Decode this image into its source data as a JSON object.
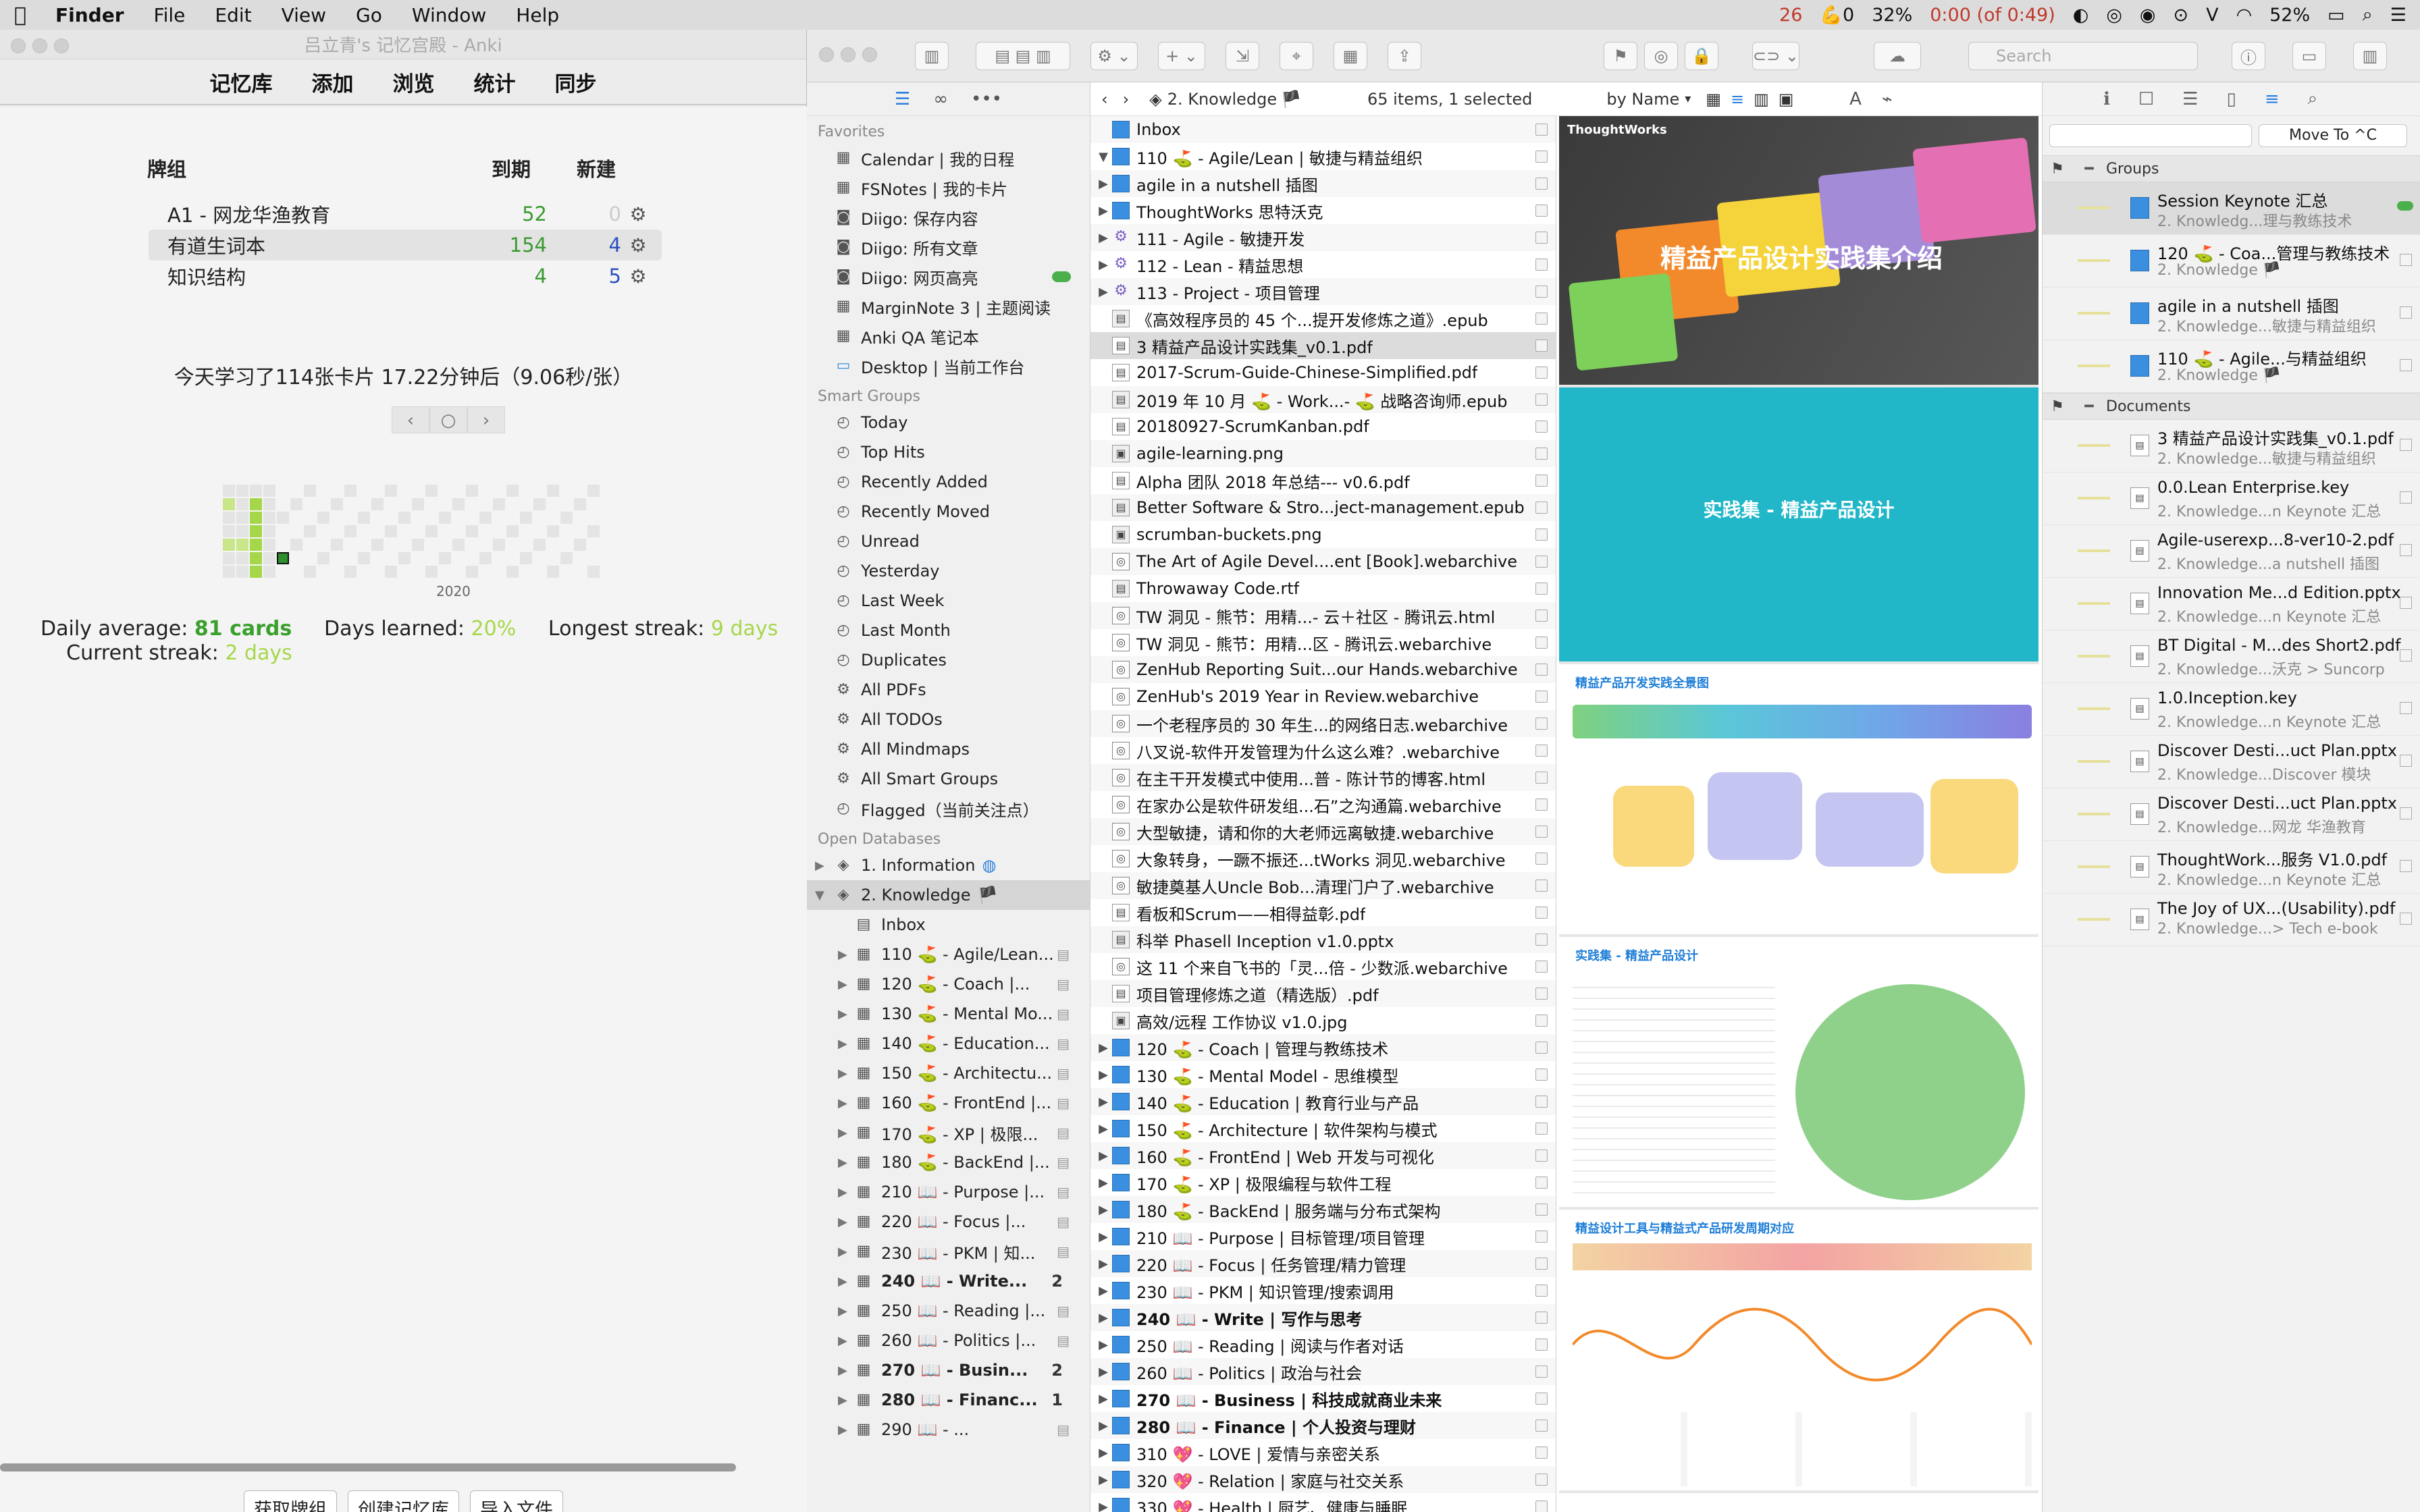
{
  "menubar": {
    "app": "Finder",
    "items": [
      "File",
      "Edit",
      "View",
      "Go",
      "Window",
      "Help"
    ],
    "status": {
      "a": "26",
      "b": "0",
      "cpu": "32%",
      "timer": "0:00 (of 0:49)",
      "battery": "52%"
    }
  },
  "anki": {
    "title": "吕立青's 记忆宫殿 - Anki",
    "toolbar": [
      "记忆库",
      "添加",
      "浏览",
      "统计",
      "同步"
    ],
    "headers": {
      "deck": "牌组",
      "due": "到期",
      "new": "新建"
    },
    "decks": [
      {
        "name": "A1 - 网龙华渔教育",
        "due": "52",
        "new": "0"
      },
      {
        "name": "有道生词本",
        "due": "154",
        "new": "4"
      },
      {
        "name": "知识结构",
        "due": "4",
        "new": "5"
      }
    ],
    "studied": "今天学习了114张卡片 17.22分钟后（9.06秒/张）",
    "year": "2020",
    "stats": {
      "daily_label": "Daily average:",
      "daily_value": "81 cards",
      "days_label": "Days learned:",
      "days_value": "20%",
      "longest_label": "Longest streak:",
      "longest_value": "9 days",
      "current_label": "Current streak:",
      "current_value": "2 days"
    },
    "bottom": [
      "获取牌组",
      "创建记忆库",
      "导入文件"
    ]
  },
  "dt": {
    "search_placeholder": "Search",
    "path": "2. Knowledge",
    "count": "65 items, 1 selected",
    "sort": "by Name",
    "move": "Move To ^C",
    "sidebar": {
      "favorites_title": "Favorites",
      "favorites": [
        "Calendar | 我的日程",
        "FSNotes | 我的卡片",
        "Diigo: 保存内容",
        "Diigo: 所有文章",
        "Diigo: 网页高亮",
        "MarginNote 3 | 主题阅读",
        "Anki QA 笔记本",
        "Desktop | 当前工作台"
      ],
      "smart_title": "Smart Groups",
      "smart": [
        "Today",
        "Top Hits",
        "Recently Added",
        "Recently Moved",
        "Unread",
        "Yesterday",
        "Last Week",
        "Last Month",
        "Duplicates",
        "All PDFs",
        "All TODOs",
        "All Mindmaps",
        "All Smart Groups",
        "Flagged（当前关注点）"
      ],
      "db_title": "Open Databases",
      "databases": [
        "1. Information",
        "2. Knowledge"
      ],
      "groups": [
        "Inbox",
        "110 ⛳ - Agile/Lean...",
        "120 ⛳ - Coach |...",
        "130 ⛳ - Mental Mo...",
        "140 ⛳ - Education...",
        "150 ⛳ - Architectu...",
        "160 ⛳ - FrontEnd |...",
        "170 ⛳ - XP | 极限...",
        "180 ⛳ - BackEnd |...",
        "210 📖 - Purpose |...",
        "220 📖 - Focus |...",
        "230 📖 - PKM | 知...",
        "240 📖 - Write...",
        "250 📖 - Reading |...",
        "260 📖 - Politics |...",
        "270 📖 - Busin...",
        "280 📖 - Financ...",
        "290 📖 - ..."
      ],
      "group_counts": [
        "",
        "",
        "",
        "",
        "",
        "",
        "",
        "",
        "",
        "",
        "",
        "",
        "2",
        "",
        "",
        "2",
        "1",
        ""
      ]
    },
    "list": [
      {
        "t": "Inbox",
        "k": "grp",
        "d": ""
      },
      {
        "t": "110 ⛳ - Agile/Lean | 敏捷与精益组织",
        "k": "grp",
        "d": "▼"
      },
      {
        "t": "agile in a nutshell 插图",
        "k": "grp",
        "d": "▶"
      },
      {
        "t": "ThoughtWorks 思特沃克",
        "k": "grp",
        "d": "▶"
      },
      {
        "t": "111 - Agile - 敏捷开发",
        "k": "smart",
        "d": "▶"
      },
      {
        "t": "112 - Lean - 精益思想",
        "k": "smart",
        "d": "▶"
      },
      {
        "t": "113 - Project - 项目管理",
        "k": "smart",
        "d": "▶"
      },
      {
        "t": "《高效程序员的 45 个...提开发修炼之道》.epub",
        "k": "doc",
        "d": ""
      },
      {
        "t": "3 精益产品设计实践集_v0.1.pdf",
        "k": "pdf",
        "d": "",
        "sel": true
      },
      {
        "t": "2017-Scrum-Guide-Chinese-Simplified.pdf",
        "k": "pdf",
        "d": ""
      },
      {
        "t": "2019 年 10 月 ⛳ - Work...- ⛳ 战略咨询师.epub",
        "k": "doc",
        "d": ""
      },
      {
        "t": "20180927-ScrumKanban.pdf",
        "k": "pdf",
        "d": ""
      },
      {
        "t": "agile-learning.png",
        "k": "img",
        "d": ""
      },
      {
        "t": "Alpha 团队 2018 年总结--- v0.6.pdf",
        "k": "pdf",
        "d": ""
      },
      {
        "t": "Better Software & Stro...ject-management.epub",
        "k": "doc",
        "d": ""
      },
      {
        "t": "scrumban-buckets.png",
        "k": "img",
        "d": ""
      },
      {
        "t": "The Art of Agile Devel....ent [Book].webarchive",
        "k": "web",
        "d": ""
      },
      {
        "t": "Throwaway Code.rtf",
        "k": "doc",
        "d": ""
      },
      {
        "t": "TW 洞见 - 熊节：用精...- 云＋社区 - 腾讯云.html",
        "k": "web",
        "d": ""
      },
      {
        "t": "TW 洞见 - 熊节：用精...区 - 腾讯云.webarchive",
        "k": "web",
        "d": ""
      },
      {
        "t": "ZenHub Reporting Suit...our Hands.webarchive",
        "k": "web",
        "d": ""
      },
      {
        "t": "ZenHub's 2019 Year in Review.webarchive",
        "k": "web",
        "d": ""
      },
      {
        "t": "一个老程序员的 30 年生...的网络日志.webarchive",
        "k": "web",
        "d": ""
      },
      {
        "t": "八叉说-软件开发管理为什么这么难？.webarchive",
        "k": "web",
        "d": ""
      },
      {
        "t": "在主干开发模式中使用...普 - 陈计节的博客.html",
        "k": "web",
        "d": ""
      },
      {
        "t": "在家办公是软件研发组...石”之沟通篇.webarchive",
        "k": "web",
        "d": ""
      },
      {
        "t": "大型敏捷，请和你的大老师远离敏捷.webarchive",
        "k": "web",
        "d": ""
      },
      {
        "t": "大象转身，一蹶不振还...tWorks 洞见.webarchive",
        "k": "web",
        "d": ""
      },
      {
        "t": "敏捷奠基人Uncle Bob...清理门户了.webarchive",
        "k": "web",
        "d": ""
      },
      {
        "t": "看板和Scrum——相得益彰.pdf",
        "k": "pdf",
        "d": ""
      },
      {
        "t": "科举 Phasell Inception v1.0.pptx",
        "k": "doc",
        "d": ""
      },
      {
        "t": "这 11 个来自飞书的「灵...倍 - 少数派.webarchive",
        "k": "web",
        "d": ""
      },
      {
        "t": "项目管理修炼之道（精选版）.pdf",
        "k": "pdf",
        "d": ""
      },
      {
        "t": "高效/远程 工作协议 v1.0.jpg",
        "k": "img",
        "d": ""
      },
      {
        "t": "120 ⛳ - Coach | 管理与教练技术",
        "k": "grp",
        "d": "▶"
      },
      {
        "t": "130 ⛳ - Mental Model - 思维模型",
        "k": "grp",
        "d": "▶"
      },
      {
        "t": "140 ⛳ - Education | 教育行业与产品",
        "k": "grp",
        "d": "▶"
      },
      {
        "t": "150 ⛳ - Architecture | 软件架构与模式",
        "k": "grp",
        "d": "▶"
      },
      {
        "t": "160 ⛳ - FrontEnd | Web 开发与可视化",
        "k": "grp",
        "d": "▶"
      },
      {
        "t": "170 ⛳ - XP | 极限编程与软件工程",
        "k": "grp",
        "d": "▶"
      },
      {
        "t": "180 ⛳ - BackEnd | 服务端与分布式架构",
        "k": "grp",
        "d": "▶"
      },
      {
        "t": "210 📖 - Purpose | 目标管理/项目管理",
        "k": "grp",
        "d": "▶"
      },
      {
        "t": "220 📖 - Focus | 任务管理/精力管理",
        "k": "grp",
        "d": "▶"
      },
      {
        "t": "230 📖 - PKM | 知识管理/搜索调用",
        "k": "grp",
        "d": "▶"
      },
      {
        "t": "240 📖 - Write | 写作与思考",
        "k": "grp",
        "d": "▶",
        "bold": true
      },
      {
        "t": "250 📖 - Reading | 阅读与作者对话",
        "k": "grp",
        "d": "▶"
      },
      {
        "t": "260 📖 - Politics | 政治与社会",
        "k": "grp",
        "d": "▶"
      },
      {
        "t": "270 📖 - Business | 科技成就商业未来",
        "k": "grp",
        "d": "▶",
        "bold": true
      },
      {
        "t": "280 📖 - Finance | 个人投资与理财",
        "k": "grp",
        "d": "▶",
        "bold": true
      },
      {
        "t": "310 💖 - LOVE | 爱情与亲密关系",
        "k": "grp",
        "d": "▶"
      },
      {
        "t": "320 💖 - Relation | 家庭与社交关系",
        "k": "grp",
        "d": "▶"
      },
      {
        "t": "330 💖 - Health | 厨艺、健康与睡眠",
        "k": "grp",
        "d": "▶"
      }
    ],
    "preview": {
      "logo": "ThoughtWorks",
      "s1_title": "精益产品设计实践集介绍",
      "s2_title": "实践集 - 精益产品设计",
      "s3_title": "精益产品开发实践全景图",
      "s4_title": "实践集 - 精益产品设计",
      "s5_title": "精益设计工具与精益式产品研发周期对应"
    },
    "inspector": {
      "groups_title": "Groups",
      "documents_title": "Documents",
      "groups": [
        {
          "n1": "Session Keynote 汇总",
          "n2": "2. Knowledg...理与教练技术",
          "sel": true
        },
        {
          "n1": "120 ⛳ - Coa...管理与教练技术",
          "n2": "2. Knowledge 🏴"
        },
        {
          "n1": "agile in a nutshell 插图",
          "n2": "2. Knowledge...敏捷与精益组织"
        },
        {
          "n1": "110 ⛳ - Agile...与精益组织",
          "n2": "2. Knowledge 🏴"
        }
      ],
      "documents": [
        {
          "n1": "3 精益产品设计实践集_v0.1.pdf",
          "n2": "2. Knowledge...敏捷与精益组织"
        },
        {
          "n1": "0.0.Lean Enterprise.key",
          "n2": "2. Knowledge...n Keynote 汇总"
        },
        {
          "n1": "Agile-userexp...8-ver10-2.pdf",
          "n2": "2. Knowledge...a nutshell 插图"
        },
        {
          "n1": "Innovation Me...d Edition.pptx",
          "n2": "2. Knowledge...n Keynote 汇总"
        },
        {
          "n1": "BT Digital - M...des Short2.pdf",
          "n2": "2. Knowledge...沃克 > Suncorp"
        },
        {
          "n1": "1.0.Inception.key",
          "n2": "2. Knowledge...n Keynote 汇总"
        },
        {
          "n1": "Discover Desti...uct Plan.pptx",
          "n2": "2. Knowledge...Discover 模块"
        },
        {
          "n1": "Discover Desti...uct Plan.pptx",
          "n2": "2. Knowledge...网龙 华渔教育"
        },
        {
          "n1": "ThoughtWork...服务 V1.0.pdf",
          "n2": "2. Knowledge...n Keynote 汇总"
        },
        {
          "n1": "The Joy of UX...(Usability).pdf",
          "n2": "2. Knowledge...> Tech e-book"
        }
      ]
    }
  }
}
